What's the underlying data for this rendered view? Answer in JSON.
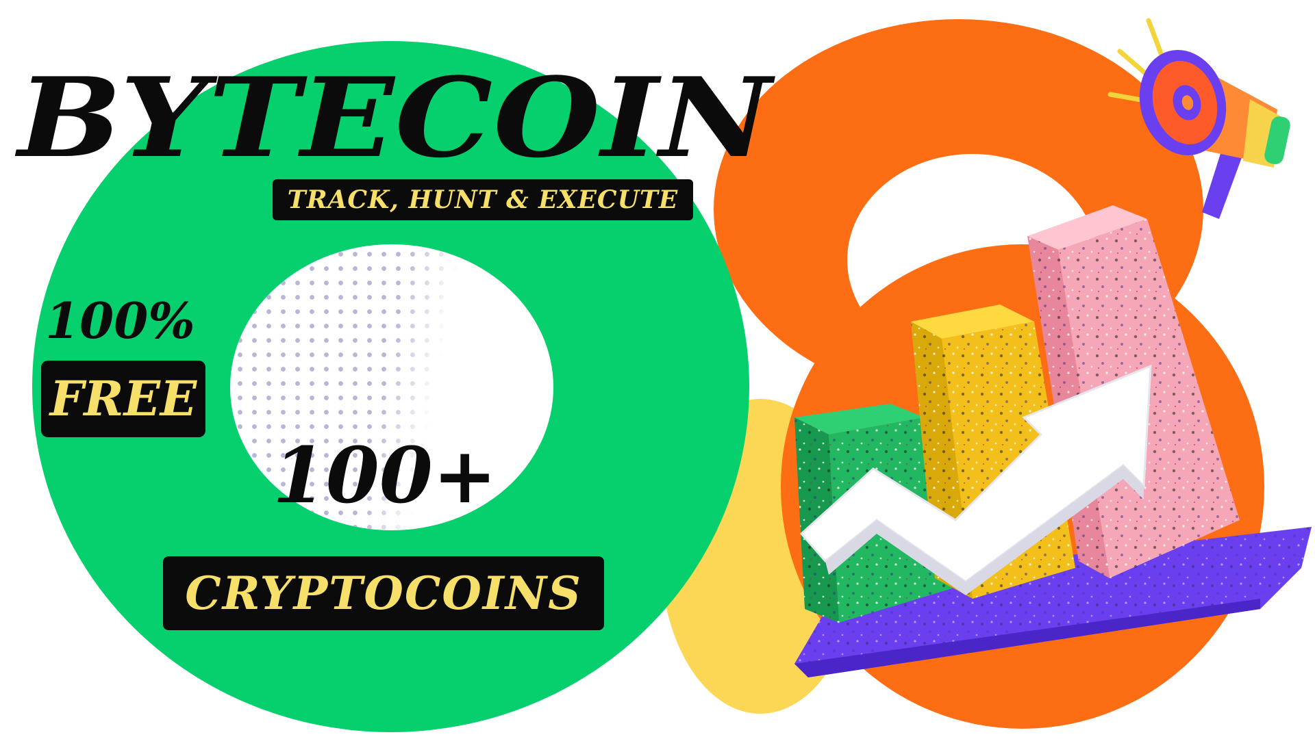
{
  "hero": {
    "title": "BYTECOIN",
    "tagline": "TRACK, HUNT & EXECUTE",
    "percent": "100%",
    "free": "FREE",
    "count": "100+",
    "coins": "CRYPTOCOINS"
  },
  "colors": {
    "green": "#06cf6e",
    "orange": "#fd6d14",
    "yellow": "#fbd755",
    "badge_text": "#f6e06a",
    "purple": "#6a3ff0",
    "pink": "#f5a6b7"
  },
  "icons": {
    "chart": "bar-chart-growth-icon",
    "megaphone": "megaphone-icon"
  }
}
